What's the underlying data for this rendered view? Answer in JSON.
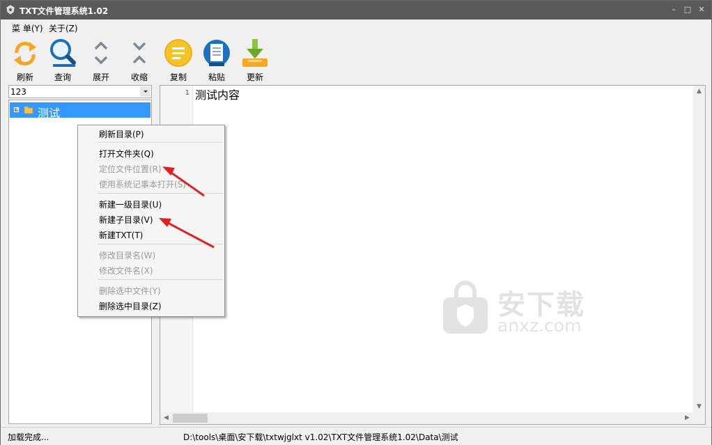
{
  "window": {
    "title": "TXT文件管理系统1.02",
    "controls": {
      "minimize": "–",
      "maximize": "□",
      "close": "✕"
    }
  },
  "menubar": {
    "items": [
      {
        "label": "菜 单(Y)"
      },
      {
        "label": "关于(Z)"
      }
    ]
  },
  "toolbar": {
    "buttons": [
      {
        "label": "刷新",
        "icon": "refresh-icon"
      },
      {
        "label": "查询",
        "icon": "search-icon"
      },
      {
        "label": "展开",
        "icon": "expand-icon"
      },
      {
        "label": "收缩",
        "icon": "collapse-icon"
      },
      {
        "label": "复制",
        "icon": "copy-icon"
      },
      {
        "label": "粘贴",
        "icon": "paste-icon"
      },
      {
        "label": "更新",
        "icon": "update-icon"
      }
    ]
  },
  "sidebar": {
    "combo_value": "123",
    "tree": [
      {
        "label": "测试",
        "selected": true
      }
    ]
  },
  "editor": {
    "line_numbers": [
      "1"
    ],
    "content": "测试内容"
  },
  "context_menu": {
    "items": [
      {
        "label": "刷新目录(P)",
        "enabled": true
      },
      {
        "label": "打开文件夹(Q)",
        "enabled": true
      },
      {
        "label": "定位文件位置(R)",
        "enabled": false
      },
      {
        "label": "使用系统记事本打开(S)",
        "enabled": false
      },
      {
        "label": "新建一级目录(U)",
        "enabled": true
      },
      {
        "label": "新建子目录(V)",
        "enabled": true
      },
      {
        "label": "新建TXT(T)",
        "enabled": true
      },
      {
        "label": "修改目录名(W)",
        "enabled": false
      },
      {
        "label": "修改文件名(X)",
        "enabled": false
      },
      {
        "label": "删除选中文件(Y)",
        "enabled": false
      },
      {
        "label": "删除选中目录(Z)",
        "enabled": true
      }
    ]
  },
  "watermark": {
    "title": "安下载",
    "subtitle": "anxz.com"
  },
  "statusbar": {
    "left": "加载完成...",
    "path": "D:\\tools\\桌面\\安下载\\txtwjglxt v1.02\\TXT文件管理系统1.02\\Data\\测试"
  },
  "colors": {
    "title_bar": "#5a5a5a",
    "selection": "#3399ff",
    "annotation_arrow": "#e02020",
    "disabled_text": "#9a9a9a"
  }
}
